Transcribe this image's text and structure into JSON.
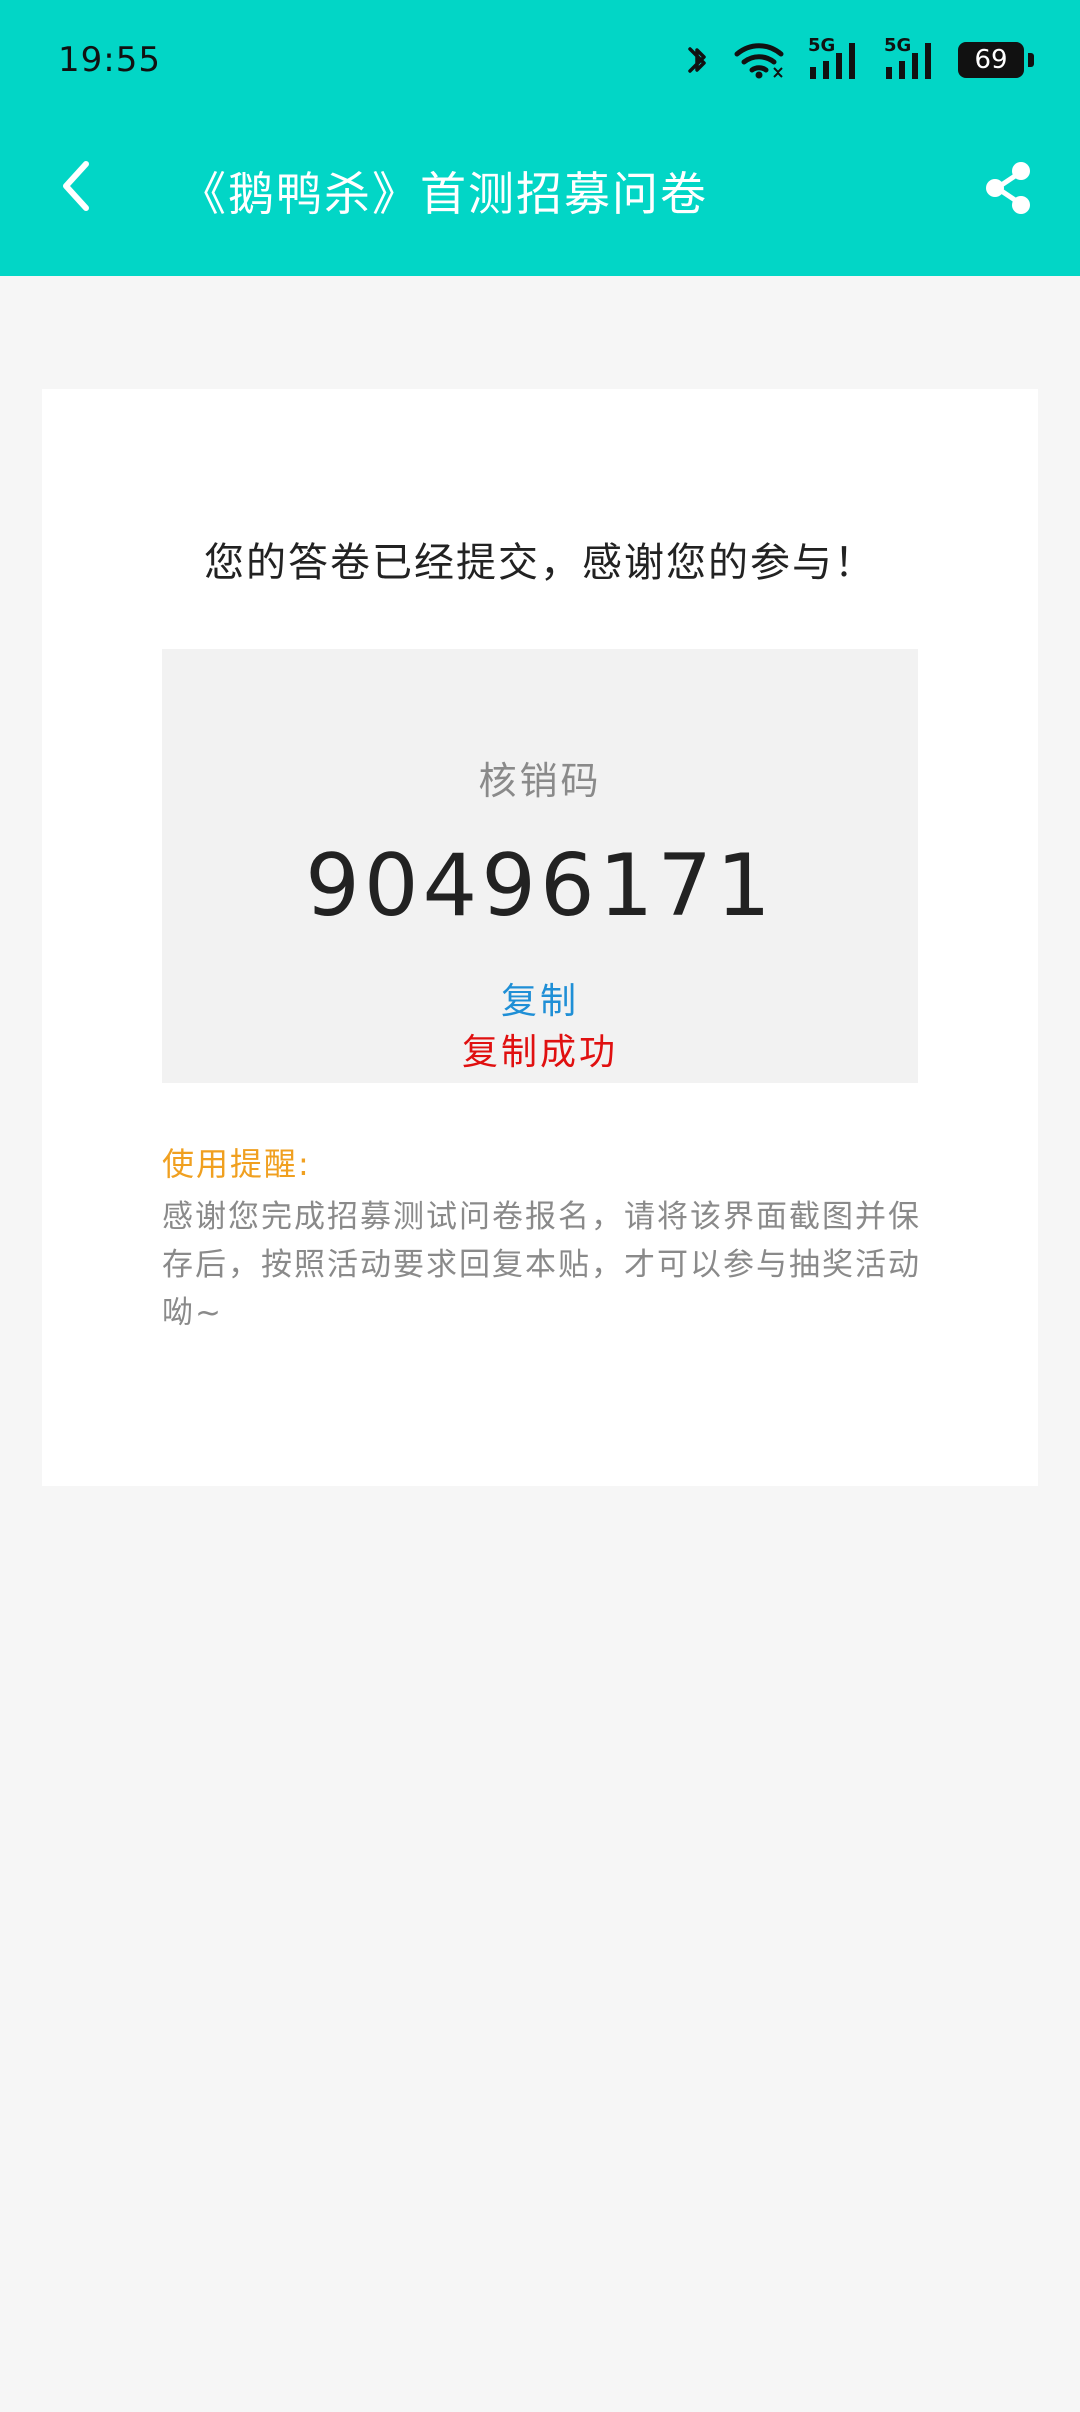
{
  "status_bar": {
    "time": "19:55",
    "battery": "69",
    "network_1": "5G",
    "network_2": "5G",
    "icons": [
      "bluetooth-icon",
      "wifi-icon",
      "signal-5g-icon",
      "signal-5g-icon",
      "battery-icon"
    ]
  },
  "app_bar": {
    "title": "《鹅鸭杀》首测招募问卷",
    "back_icon": "chevron-left-icon",
    "share_icon": "share-icon"
  },
  "content": {
    "message": "您的答卷已经提交，感谢您的参与！",
    "code_label": "核销码",
    "code_value": "90496171",
    "copy_label": "复制",
    "copy_success": "复制成功",
    "tips_title": "使用提醒:",
    "tips_text": "感谢您完成招募测试问卷报名，请将该界面截图并保存后，按照活动要求回复本贴，才可以参与抽奖活动呦~"
  },
  "colors": {
    "brand": "#02d6c6",
    "copy": "#1f8fd6",
    "success": "#e01010",
    "tips_title": "#f0a020"
  }
}
